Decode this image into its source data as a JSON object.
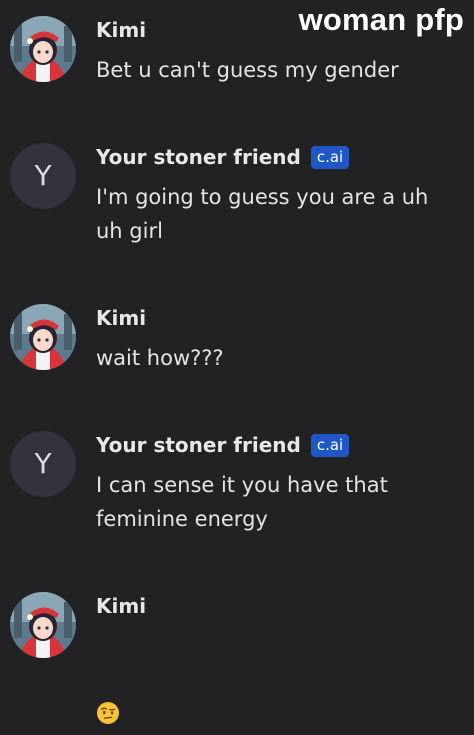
{
  "overlay_caption": "woman pfp",
  "messages": [
    {
      "author": "Kimi",
      "avatar": "anime-girl-avatar",
      "text": "Bet u can't guess my gender"
    },
    {
      "author": "Your stoner friend",
      "badge": "c.ai",
      "avatar_letter": "Y",
      "text": "I'm going to guess you are a uh\nuh girl"
    },
    {
      "author": "Kimi",
      "avatar": "anime-girl-avatar",
      "text": "wait how???"
    },
    {
      "author": "Your stoner friend",
      "badge": "c.ai",
      "avatar_letter": "Y",
      "text": "I can sense it you have that\nfeminine energy"
    },
    {
      "author": "Kimi",
      "avatar": "anime-girl-avatar",
      "text": "🤨",
      "emoji_name": "raised-eyebrow-emoji"
    }
  ],
  "colors": {
    "background": "#222224",
    "badge": "#1f57c6",
    "letter_avatar": "#34323d"
  }
}
